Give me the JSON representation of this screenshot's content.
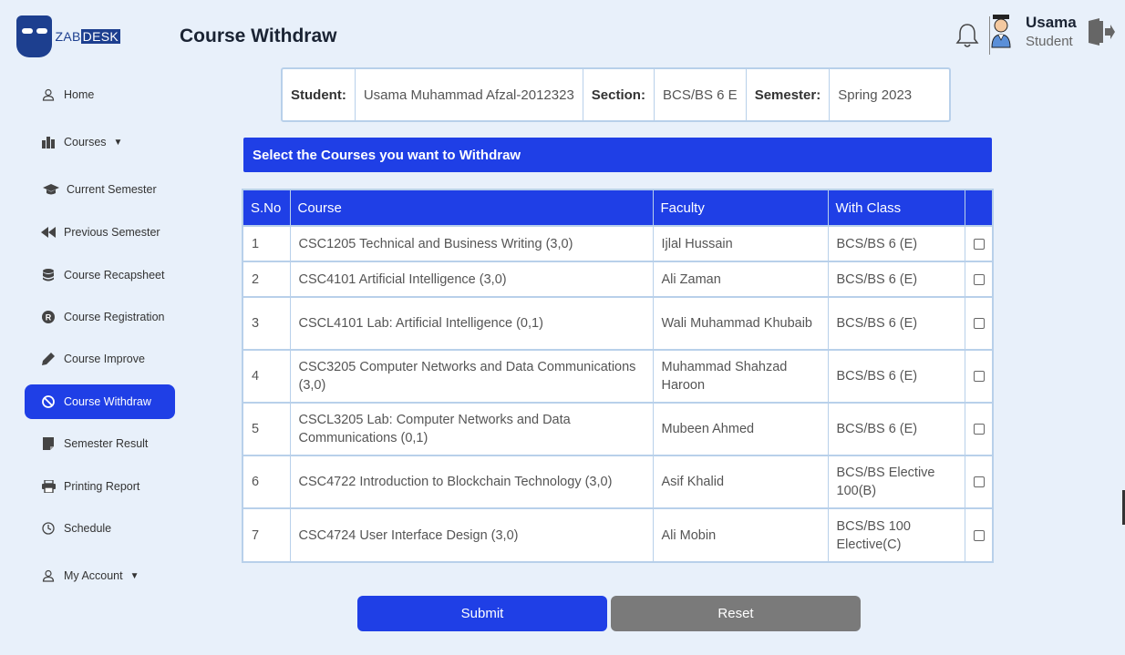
{
  "header": {
    "logo_text_left": "ZAB",
    "logo_text_right": "DESK",
    "page_title": "Course Withdraw",
    "user_name": "Usama",
    "user_role": "Student"
  },
  "sidebar": {
    "items": [
      {
        "label": "Home",
        "icon": "user-icon"
      },
      {
        "label": "Courses",
        "icon": "books-icon",
        "has_caret": true
      },
      {
        "label": "Current Semester",
        "icon": "graduation-cap-icon"
      },
      {
        "label": "Previous Semester",
        "icon": "backward-icon"
      },
      {
        "label": "Course Recapsheet",
        "icon": "database-icon"
      },
      {
        "label": "Course Registration",
        "icon": "registered-icon"
      },
      {
        "label": "Course Improve",
        "icon": "pen-icon"
      },
      {
        "label": "Course Withdraw",
        "icon": "ban-icon",
        "active": true
      },
      {
        "label": "Semester Result",
        "icon": "report-icon"
      },
      {
        "label": "Printing Report",
        "icon": "printer-icon"
      },
      {
        "label": "Schedule",
        "icon": "clock-icon"
      },
      {
        "label": "My Account",
        "icon": "user-icon",
        "has_caret": true
      }
    ]
  },
  "info": {
    "student_label": "Student:",
    "student_value": "Usama Muhammad Afzal-2012323",
    "section_label": "Section:",
    "section_value": "BCS/BS 6 E",
    "semester_label": "Semester:",
    "semester_value": "Spring 2023"
  },
  "banner": "Select the Courses you want to Withdraw",
  "table": {
    "headers": [
      "S.No",
      "Course",
      "Faculty",
      "With Class",
      ""
    ],
    "rows": [
      {
        "sno": "1",
        "course": "CSC1205 Technical and Business Writing (3,0)",
        "faculty": "Ijlal Hussain",
        "with_class": "BCS/BS 6 (E)"
      },
      {
        "sno": "2",
        "course": "CSC4101 Artificial Intelligence (3,0)",
        "faculty": "Ali Zaman",
        "with_class": "BCS/BS 6 (E)"
      },
      {
        "sno": "3",
        "course": "CSCL4101 Lab: Artificial Intelligence (0,1)",
        "faculty": "Wali Muhammad Khubaib",
        "with_class": "BCS/BS 6 (E)"
      },
      {
        "sno": "4",
        "course": "CSC3205 Computer Networks and Data Communications (3,0)",
        "faculty": "Muhammad Shahzad Haroon",
        "with_class": "BCS/BS 6 (E)"
      },
      {
        "sno": "5",
        "course": "CSCL3205 Lab: Computer Networks and Data Communications (0,1)",
        "faculty": "Mubeen Ahmed",
        "with_class": "BCS/BS 6 (E)"
      },
      {
        "sno": "6",
        "course": "CSC4722 Introduction to Blockchain Technology (3,0)",
        "faculty": "Asif Khalid",
        "with_class": "BCS/BS Elective 100(B)"
      },
      {
        "sno": "7",
        "course": "CSC4724 User Interface Design (3,0)",
        "faculty": "Ali Mobin",
        "with_class": "BCS/BS 100 Elective(C)"
      }
    ]
  },
  "buttons": {
    "submit": "Submit",
    "reset": "Reset"
  },
  "colors": {
    "accent": "#1f3fe6",
    "reset_button": "#7a7a7a",
    "background": "#e8f0fa",
    "logo": "#1d3f8f"
  }
}
